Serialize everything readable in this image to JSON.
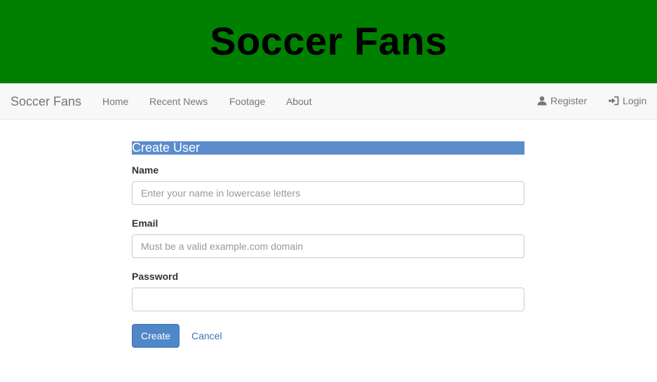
{
  "banner": {
    "title": "Soccer Fans"
  },
  "navbar": {
    "brand": "Soccer Fans",
    "links": [
      "Home",
      "Recent News",
      "Footage",
      "About"
    ],
    "right": [
      {
        "label": "Register",
        "icon": "user-icon"
      },
      {
        "label": "Login",
        "icon": "login-icon"
      }
    ]
  },
  "form": {
    "title": "Create User",
    "fields": [
      {
        "label": "Name",
        "placeholder": "Enter your name in lowercase letters",
        "value": ""
      },
      {
        "label": "Email",
        "placeholder": "Must be a valid example.com domain",
        "value": ""
      },
      {
        "label": "Password",
        "placeholder": "",
        "value": ""
      }
    ],
    "submit_label": "Create",
    "cancel_label": "Cancel"
  },
  "colors": {
    "banner_bg": "#008000",
    "title_bar": "#5b8ccc",
    "primary_button": "#4f87c7",
    "link": "#3b72b8"
  }
}
